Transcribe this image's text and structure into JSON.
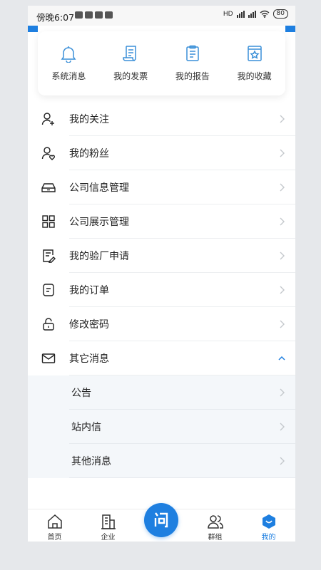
{
  "status_bar": {
    "time": "傍晚6:07",
    "network": "HD",
    "battery": "80"
  },
  "quick_actions": [
    {
      "label": "系统消息",
      "icon": "bell-icon"
    },
    {
      "label": "我的发票",
      "icon": "invoice-icon"
    },
    {
      "label": "我的报告",
      "icon": "report-icon"
    },
    {
      "label": "我的收藏",
      "icon": "favorite-icon"
    }
  ],
  "menu": {
    "items": [
      {
        "label": "我的关注",
        "icon": "user-plus-icon"
      },
      {
        "label": "我的粉丝",
        "icon": "user-heart-icon"
      },
      {
        "label": "公司信息管理",
        "icon": "inbox-icon"
      },
      {
        "label": "公司展示管理",
        "icon": "grid-icon"
      },
      {
        "label": "我的验厂申请",
        "icon": "edit-document-icon"
      },
      {
        "label": "我的订单",
        "icon": "order-icon"
      },
      {
        "label": "修改密码",
        "icon": "lock-icon"
      },
      {
        "label": "其它消息",
        "icon": "mail-icon"
      }
    ],
    "sub_items": [
      {
        "label": "公告"
      },
      {
        "label": "站内信"
      },
      {
        "label": "其他消息"
      }
    ]
  },
  "bottom_nav": [
    {
      "label": "首页",
      "icon": "home-icon"
    },
    {
      "label": "企业",
      "icon": "building-icon"
    },
    {
      "label": "",
      "icon": "question-icon"
    },
    {
      "label": "群组",
      "icon": "group-icon"
    },
    {
      "label": "我的",
      "icon": "profile-icon"
    }
  ],
  "colors": {
    "accent": "#1e7fe0",
    "quick_icon": "#3a8fd8",
    "text": "#222222",
    "chevron": "#c4c8cc"
  }
}
